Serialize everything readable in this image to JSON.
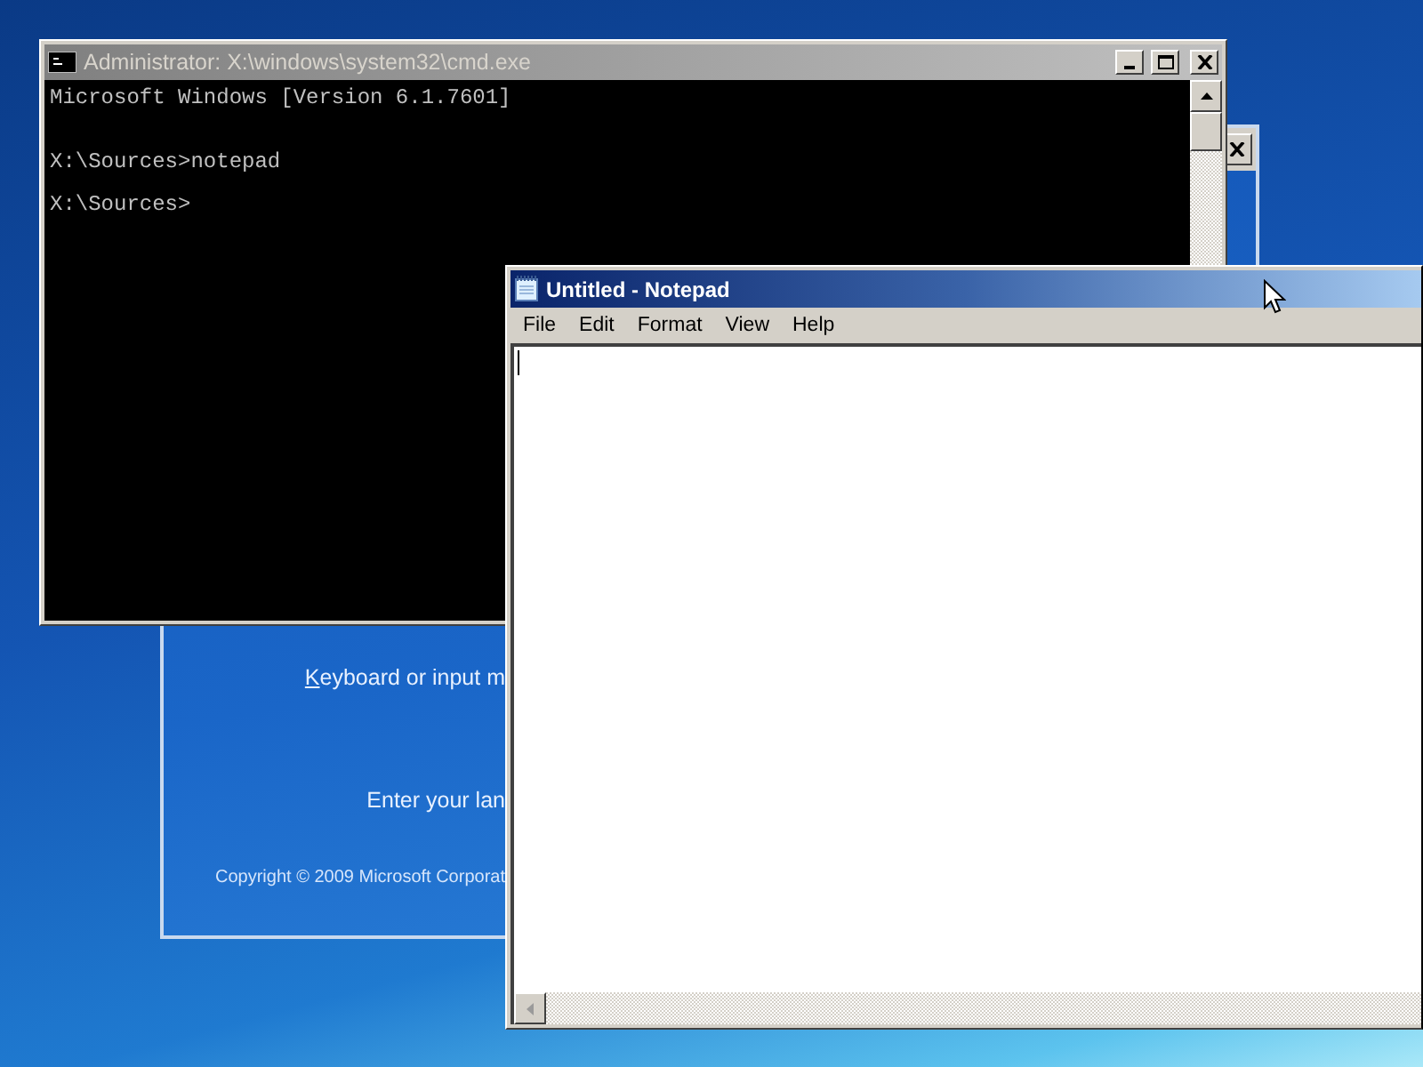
{
  "cmd_window": {
    "title": "Administrator: X:\\windows\\system32\\cmd.exe",
    "lines": [
      "Microsoft Windows [Version 6.1.7601]",
      "X:\\Sources>notepad",
      "X:\\Sources>"
    ]
  },
  "setup_window": {
    "labels": [
      "Keyboard or input m",
      "Enter your lan"
    ],
    "copyright": "Copyright © 2009 Microsoft Corporat"
  },
  "notepad": {
    "title": "Untitled - Notepad",
    "menu": [
      "File",
      "Edit",
      "Format",
      "View",
      "Help"
    ]
  }
}
